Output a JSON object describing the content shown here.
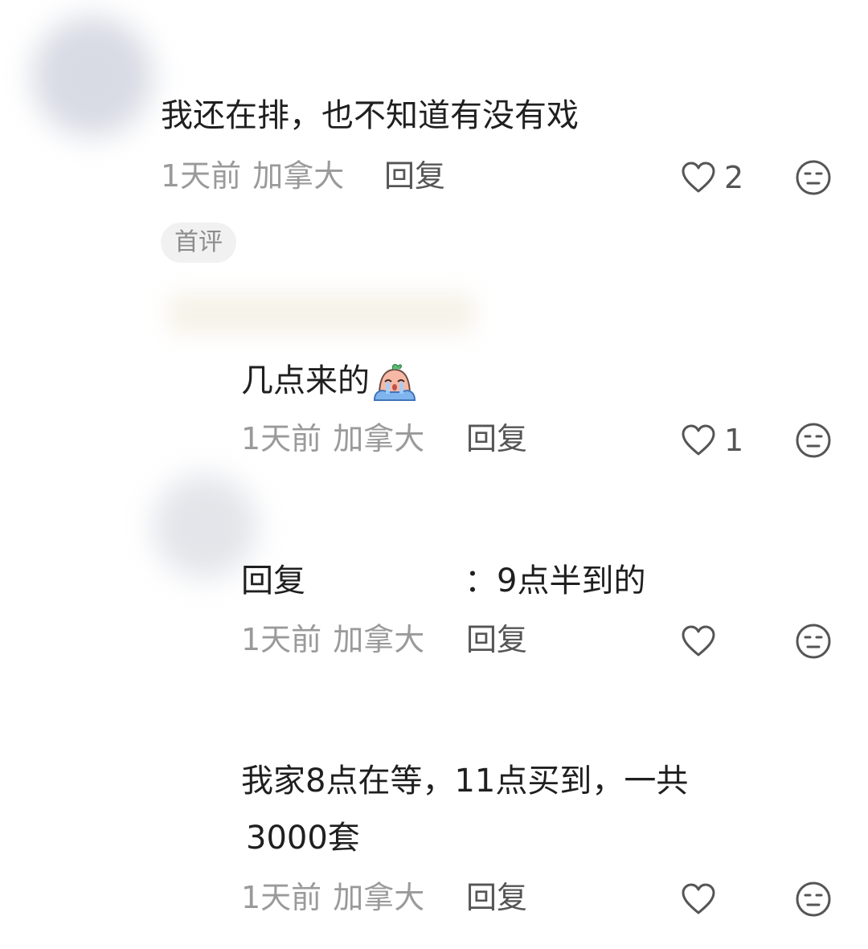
{
  "comments": [
    {
      "text": "我还在排，也不知道有没有戏",
      "time": "1天前",
      "location": "加拿大",
      "reply_label": "回复",
      "like_count": "2",
      "tag": "首评"
    },
    {
      "text": "几点来的",
      "emoji": "crying-face-emoji",
      "time": "1天前",
      "location": "加拿大",
      "reply_label": "回复",
      "like_count": "1"
    },
    {
      "text_prefix": "回复",
      "text_suffix": "：9点半到的",
      "time": "1天前",
      "location": "加拿大",
      "reply_label": "回复",
      "like_count": ""
    },
    {
      "text_line1": "我家8点在等，11点买到，一共",
      "text_line2": "3000套",
      "time": "1天前",
      "location": "加拿大",
      "reply_label": "回复",
      "like_count": ""
    }
  ],
  "icons": {
    "like": "heart-icon",
    "dislike": "neutral-face-icon"
  },
  "colors": {
    "text": "#1f1f1f",
    "meta": "#9a9a9a",
    "action": "#555555",
    "tag_bg": "#f1f1f1"
  }
}
